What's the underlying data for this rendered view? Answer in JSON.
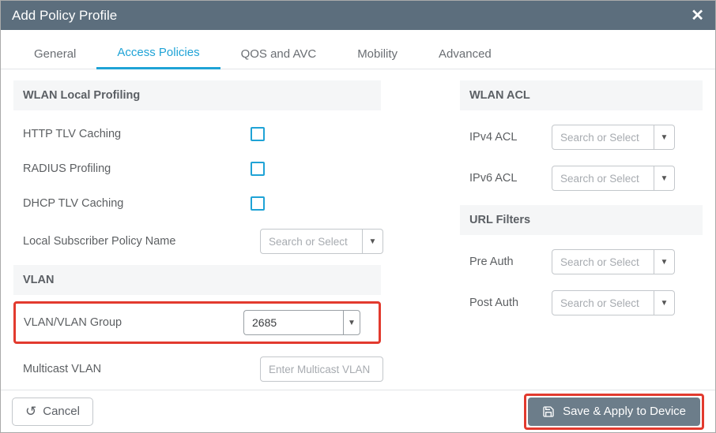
{
  "dialog": {
    "title": "Add Policy Profile"
  },
  "tabs": {
    "general": "General",
    "access_policies": "Access Policies",
    "qos_avc": "QOS and AVC",
    "mobility": "Mobility",
    "advanced": "Advanced"
  },
  "sections": {
    "wlan_local_profiling": "WLAN Local Profiling",
    "vlan": "VLAN",
    "wlan_acl": "WLAN ACL",
    "url_filters": "URL Filters"
  },
  "fields": {
    "http_tlv_caching": "HTTP TLV Caching",
    "radius_profiling": "RADIUS Profiling",
    "dhcp_tlv_caching": "DHCP TLV Caching",
    "local_subscriber_policy_name": "Local Subscriber Policy Name",
    "vlan_group": "VLAN/VLAN Group",
    "multicast_vlan": "Multicast VLAN",
    "ipv4_acl": "IPv4 ACL",
    "ipv6_acl": "IPv6 ACL",
    "pre_auth": "Pre Auth",
    "post_auth": "Post Auth"
  },
  "values": {
    "vlan_group": "2685"
  },
  "placeholders": {
    "search_or_select": "Search or Select",
    "enter_multicast_vlan": "Enter Multicast VLAN"
  },
  "buttons": {
    "cancel": "Cancel",
    "save_apply": "Save & Apply to Device"
  }
}
